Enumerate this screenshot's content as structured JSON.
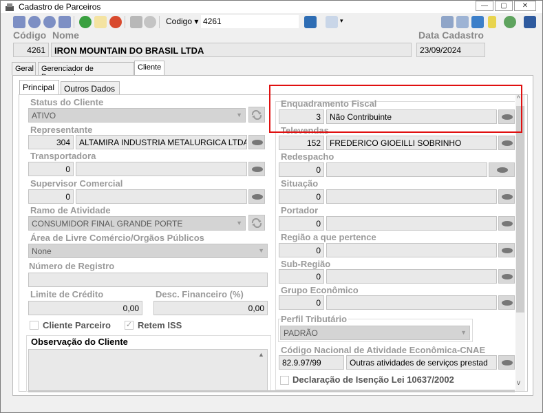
{
  "window": {
    "title": "Cadastro de Parceiros",
    "controls": [
      "minimize",
      "maximize",
      "close"
    ]
  },
  "toolbar": {
    "codigo_label": "Codigo",
    "codigo_value": "4261"
  },
  "header": {
    "codigo_label": "Código",
    "nome_label": "Nome",
    "data_label": "Data Cadastro",
    "codigo_value": "4261",
    "nome_value": "IRON MOUNTAIN DO BRASIL LTDA",
    "data_value": "23/09/2024"
  },
  "main_tabs": [
    "Geral",
    "Gerenciador de Documentos",
    "Cliente"
  ],
  "sub_tabs": [
    "Principal",
    "Outros Dados"
  ],
  "left": {
    "status_label": "Status do Cliente",
    "status_value": "ATIVO",
    "representante_label": "Representante",
    "representante_code": "304",
    "representante_name": "ALTAMIRA INDUSTRIA METALURGICA LTDA",
    "transportadora_label": "Transportadora",
    "transportadora_code": "0",
    "supervisor_label": "Supervisor Comercial",
    "supervisor_code": "0",
    "ramo_label": "Ramo de Atividade",
    "ramo_value": "CONSUMIDOR FINAL GRANDE PORTE",
    "area_label": "Área de Livre Comércio/Orgãos Públicos",
    "area_value": "None",
    "numero_label": "Número de Registro",
    "limite_label": "Limite de Crédito",
    "limite_value": "0,00",
    "desc_label": "Desc. Financeiro (%)",
    "desc_value": "0,00",
    "cliente_parceiro_label": "Cliente Parceiro",
    "retem_iss_label": "Retem ISS",
    "observacao_label": "Observação do Cliente"
  },
  "right": {
    "enquadramento_label": "Enquadramento Fiscal",
    "enquadramento_code": "3",
    "enquadramento_name": "Não Contribuinte",
    "televendas_label": "Televendas",
    "televendas_code": "152",
    "televendas_name": "FREDERICO GIOEILLI SOBRINHO",
    "redespacho_label": "Redespacho",
    "redespacho_code": "0",
    "situacao_label": "Situação",
    "situacao_code": "0",
    "portador_label": "Portador",
    "portador_code": "0",
    "regiao_label": "Região a que pertence",
    "regiao_code": "0",
    "subregiao_label": "Sub-Região",
    "subregiao_code": "0",
    "grupo_label": "Grupo Econômico",
    "grupo_code": "0",
    "perfil_label": "Perfil Tributário",
    "perfil_value": "PADRÃO",
    "cnae_label": "Código Nacional de Atividade Econômica-CNAE",
    "cnae_code": "82.9.97/99",
    "cnae_name": "Outras atividades de serviços prestad",
    "declaracao_label": "Declaração de Isenção Lei 10637/2002"
  },
  "colors": {
    "highlight": "#e01010",
    "window_bg": "#f0f0f0",
    "field_bg": "#e9e9e9",
    "label_gray": "#9a9a9a"
  }
}
